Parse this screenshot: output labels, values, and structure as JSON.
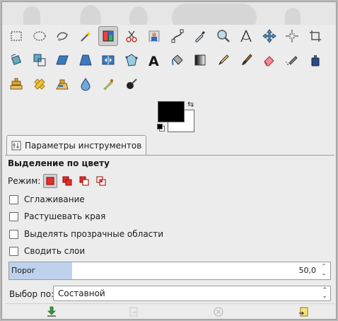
{
  "toolbox": {
    "tools": [
      {
        "name": "rect-select-tool-icon"
      },
      {
        "name": "ellipse-select-tool-icon"
      },
      {
        "name": "free-select-tool-icon"
      },
      {
        "name": "fuzzy-select-tool-icon"
      },
      {
        "name": "select-by-color-tool-icon",
        "active": true
      },
      {
        "name": "scissors-select-tool-icon"
      },
      {
        "name": "foreground-select-tool-icon"
      },
      {
        "name": "paths-tool-icon"
      },
      {
        "name": "color-picker-tool-icon"
      },
      {
        "name": "zoom-tool-icon"
      },
      {
        "name": "measure-tool-icon"
      },
      {
        "name": "move-tool-icon"
      },
      {
        "name": "align-tool-icon"
      },
      {
        "name": "crop-tool-icon"
      },
      {
        "name": "rotate-tool-icon"
      },
      {
        "name": "scale-tool-icon"
      },
      {
        "name": "shear-tool-icon"
      },
      {
        "name": "perspective-tool-icon"
      },
      {
        "name": "flip-tool-icon"
      },
      {
        "name": "cage-transform-tool-icon"
      },
      {
        "name": "text-tool-icon"
      },
      {
        "name": "bucket-fill-tool-icon"
      },
      {
        "name": "blend-tool-icon"
      },
      {
        "name": "pencil-tool-icon"
      },
      {
        "name": "paintbrush-tool-icon"
      },
      {
        "name": "eraser-tool-icon"
      },
      {
        "name": "airbrush-tool-icon"
      },
      {
        "name": "ink-tool-icon"
      },
      {
        "name": "clone-tool-icon"
      },
      {
        "name": "heal-tool-icon"
      },
      {
        "name": "perspective-clone-tool-icon"
      },
      {
        "name": "blur-sharpen-tool-icon"
      },
      {
        "name": "smudge-tool-icon"
      },
      {
        "name": "dodge-burn-tool-icon"
      }
    ]
  },
  "colors": {
    "foreground": "#000000",
    "background": "#ffffff"
  },
  "tab": {
    "label": "Параметры инструментов"
  },
  "options": {
    "title": "Выделение по цвету",
    "mode_label": "Режим:",
    "checkboxes": [
      {
        "label": "Сглаживание",
        "checked": false
      },
      {
        "label": "Растушевать края",
        "checked": false
      },
      {
        "label": "Выделять прозрачные области",
        "checked": false
      },
      {
        "label": "Сводить слои",
        "checked": false
      }
    ],
    "threshold": {
      "label": "Порог",
      "value": "50,0",
      "fraction": 0.196
    },
    "select_by": {
      "label": "Выбор по:",
      "value": "Составной"
    }
  }
}
